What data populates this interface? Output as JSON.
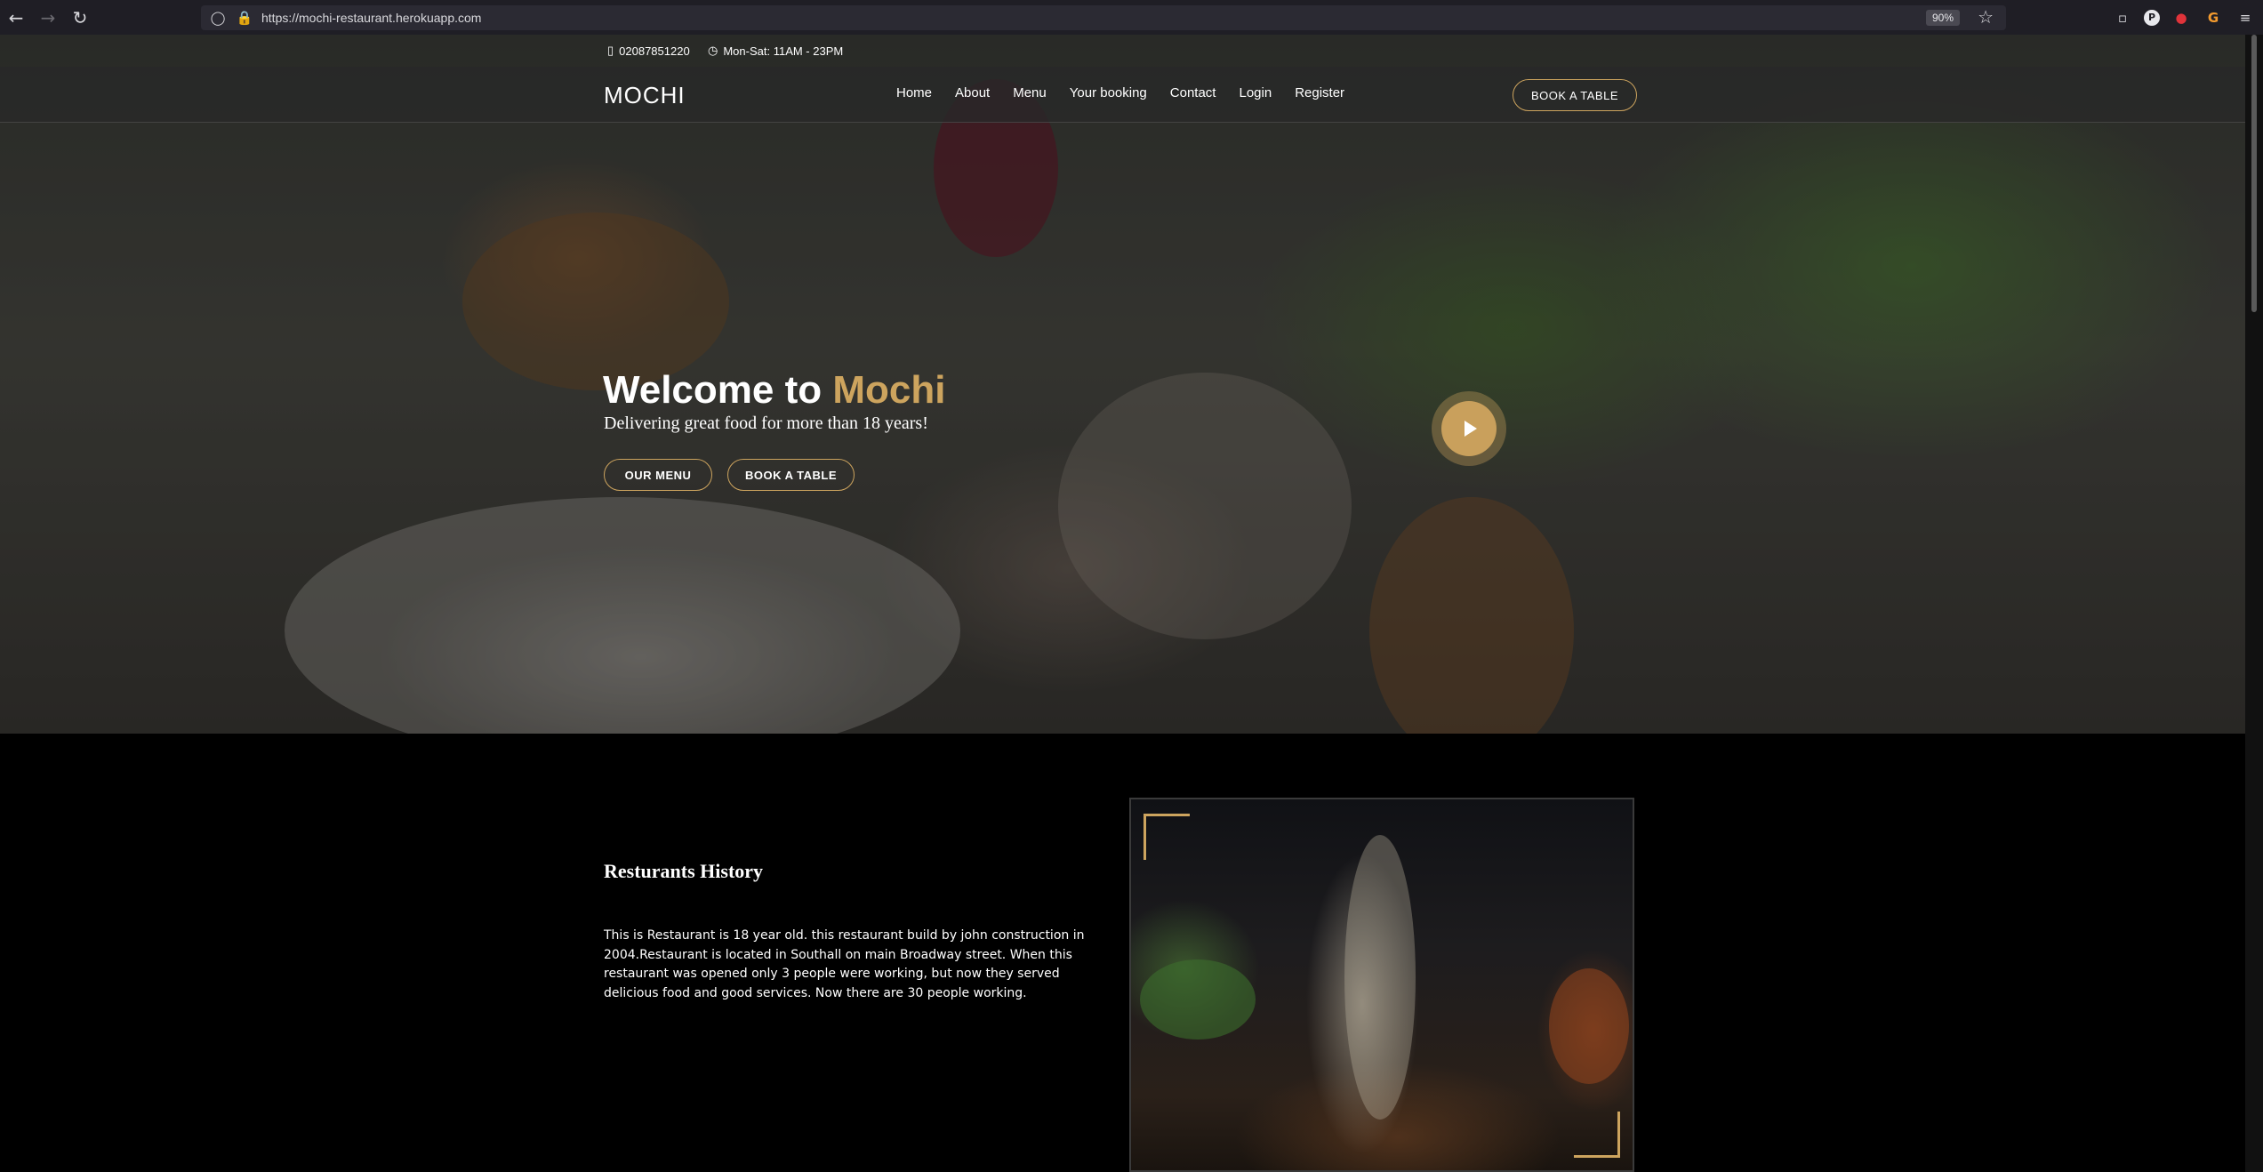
{
  "browser": {
    "url": "https://mochi-restaurant.herokuapp.com",
    "zoom": "90%",
    "back_icon": "arrow-left-icon",
    "forward_icon": "arrow-right-icon",
    "reload_icon": "reload-icon"
  },
  "topbar": {
    "phone": "02087851220",
    "hours": "Mon-Sat: 11AM - 23PM"
  },
  "header": {
    "logo": "MOCHI",
    "nav": [
      "Home",
      "About",
      "Menu",
      "Your booking",
      "Contact",
      "Login",
      "Register"
    ],
    "book_button": "BOOK A TABLE"
  },
  "hero": {
    "title_prefix": "Welcome to ",
    "title_accent": "Mochi",
    "subtitle": "Delivering great food for more than 18 years!",
    "menu_button": "OUR MENU",
    "book_button": "BOOK A TABLE"
  },
  "about": {
    "title": "Resturants History",
    "text": "This is Restaurant is 18 year old. this restaurant build by john construction in 2004.Restaurant is located in Southall on main Broadway street. When this restaurant was opened only 3 people were working, but now they served delicious food and good services. Now there are 30 people working."
  },
  "colors": {
    "accent": "#cda45e",
    "background": "#000000",
    "header_bg": "#282828"
  }
}
